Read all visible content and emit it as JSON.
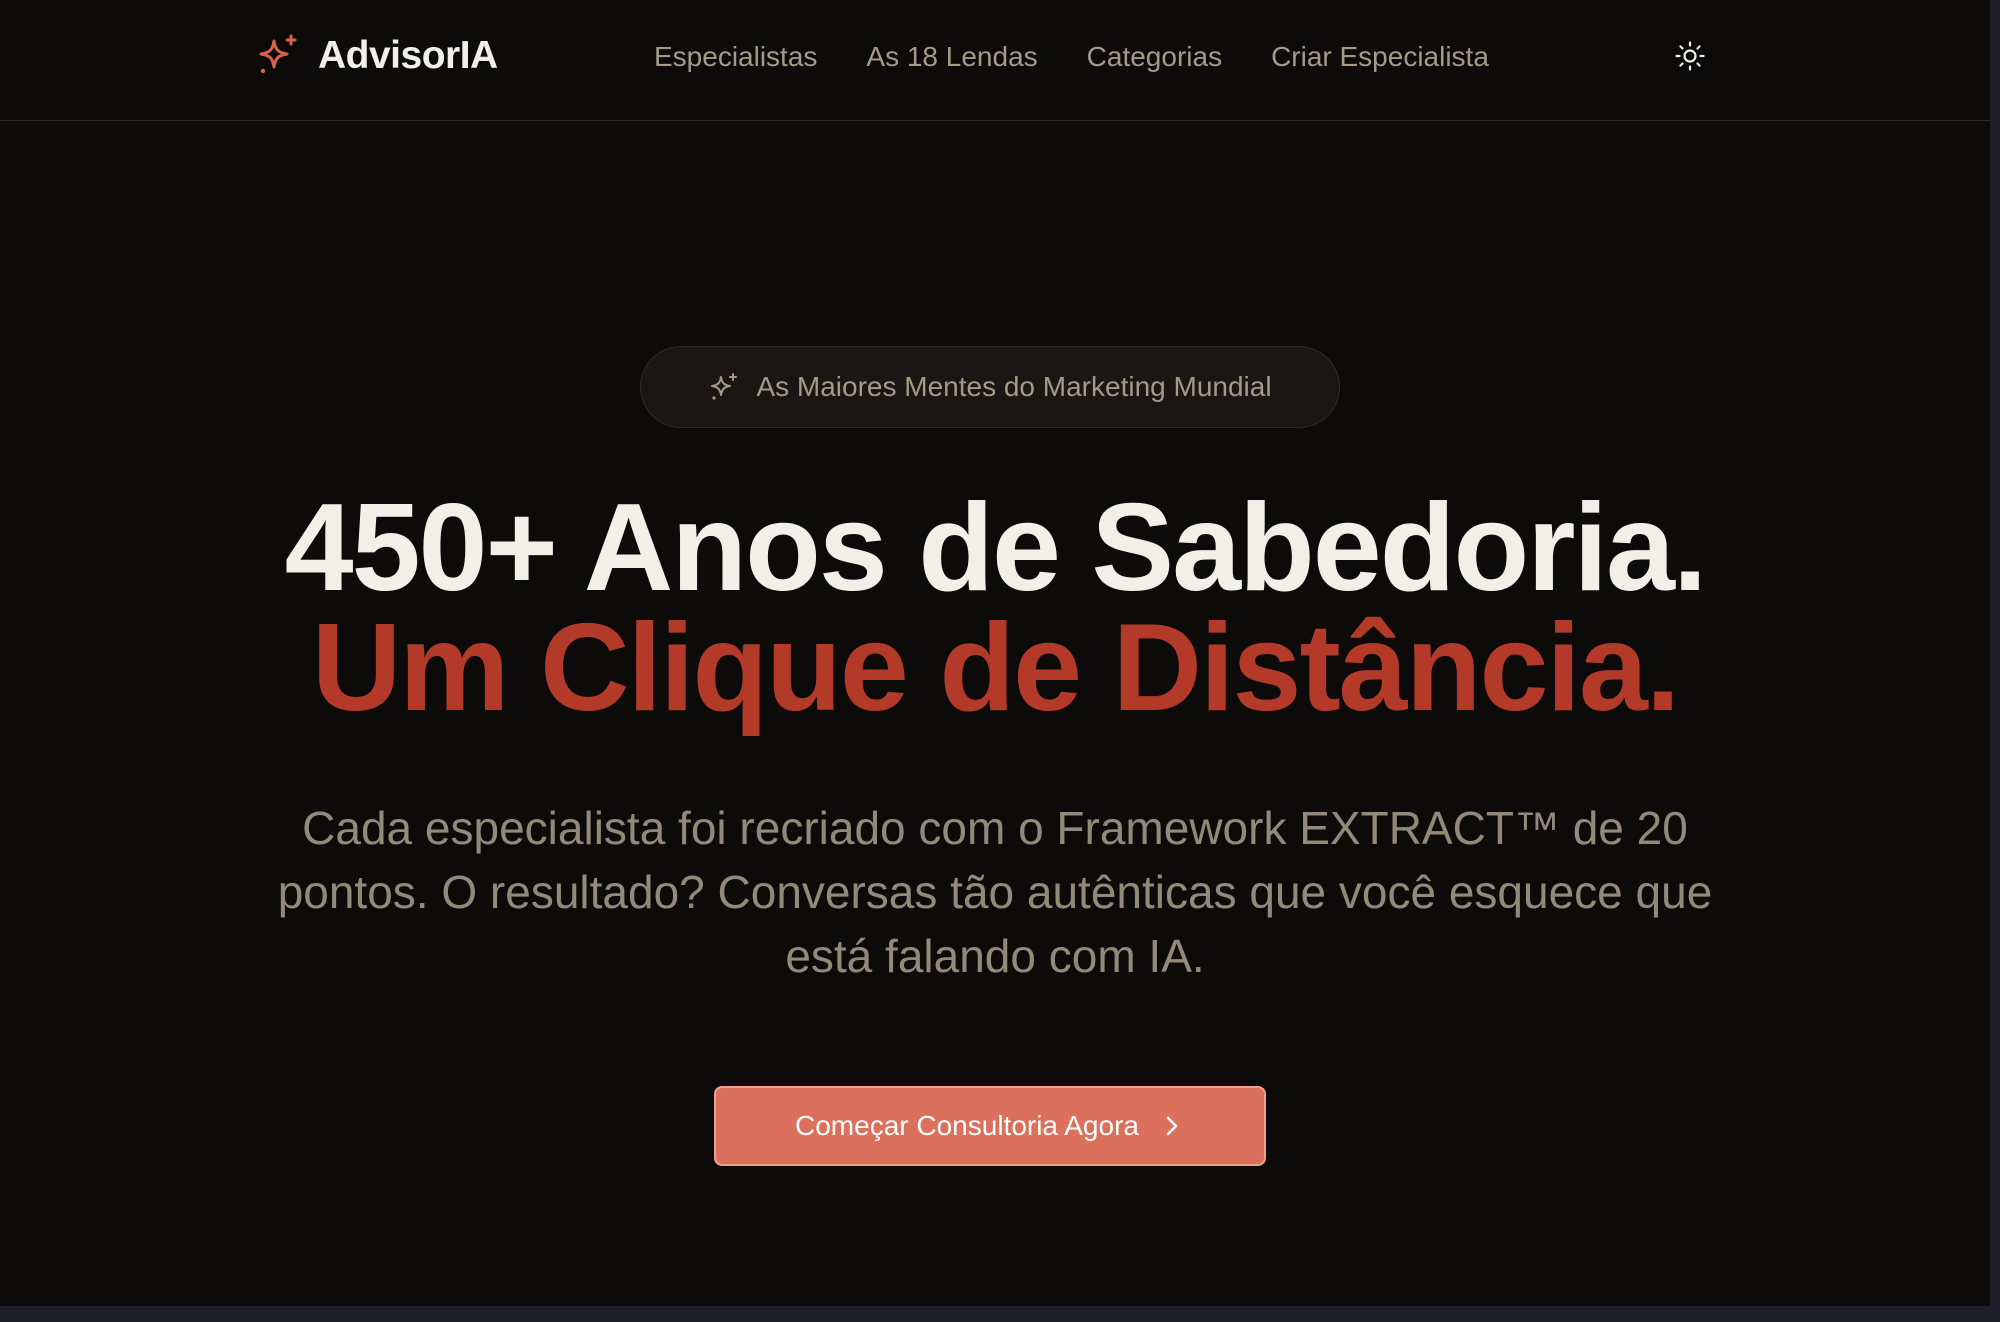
{
  "header": {
    "logo_text": "AdvisorIA",
    "logo_icon": "sparkle-icon",
    "nav": [
      {
        "label": "Especialistas"
      },
      {
        "label": "As 18 Lendas"
      },
      {
        "label": "Categorias"
      },
      {
        "label": "Criar Especialista"
      }
    ],
    "theme_toggle_icon": "sun-icon"
  },
  "hero": {
    "badge_icon": "sparkle-icon",
    "badge_text": "As Maiores Mentes do Marketing Mundial",
    "headline_line1": "450+ Anos de Sabedoria.",
    "headline_line2": "Um Clique de Distância.",
    "subtitle": "Cada especialista foi recriado com o Framework EXTRACT™ de 20 pontos. O resultado? Conversas tão autênticas que você esquece que está falando com IA.",
    "cta_label": "Começar Consultoria Agora",
    "cta_icon": "chevron-right-icon"
  },
  "colors": {
    "background": "#0d0b0a",
    "accent": "#db705d",
    "headline_accent": "#b33a29",
    "text_primary": "#f1efe8",
    "text_muted": "#a49a86"
  }
}
